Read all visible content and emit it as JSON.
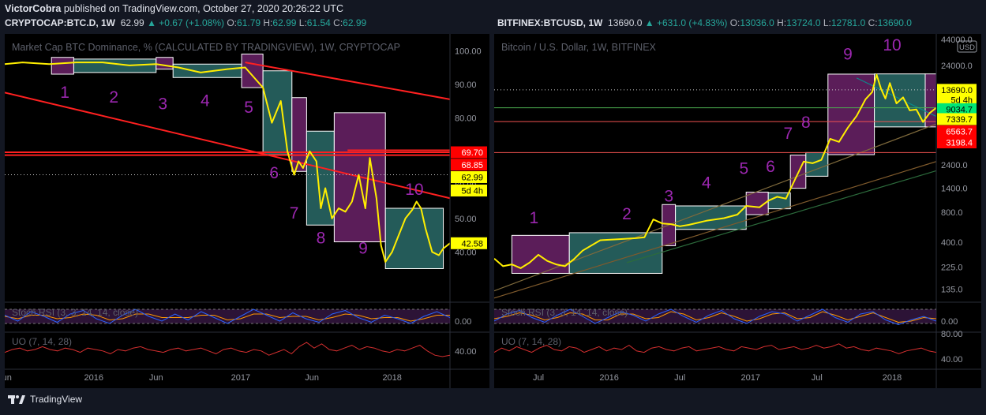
{
  "header": {
    "author": "VictorCobra",
    "published_text": "published on TradingView.com, October 27, 2020 20:26:22 UTC"
  },
  "footer": {
    "brand": "TradingView"
  },
  "colors": {
    "bull": "#26a69a",
    "bear": "#ef5350",
    "price_line": "#ffee00",
    "bg": "#131722",
    "pane": "#000000"
  },
  "chart_data": [
    {
      "type": "line",
      "symbol_header": {
        "symbol": "CRYPTOCAP:BTC.D, 1W",
        "last": "62.99",
        "change": "▲ +0.67 (+1.08%)",
        "o_label": "O:",
        "o": "61.79",
        "h_label": "H:",
        "h": "62.99",
        "l_label": "L:",
        "l": "61.54",
        "c_label": "C:",
        "c": "62.99"
      },
      "title": "Market Cap BTC Dominance, % (CALCULATED BY TRADINGVIEW), 1W, CRYPTOCAP",
      "ylim": [
        25,
        105
      ],
      "y_ticks": [
        40,
        50,
        60,
        70,
        80,
        90,
        100
      ],
      "y_tick_labels": [
        "40.00",
        "50.00",
        "60.00",
        "70.00",
        "80.00",
        "90.00",
        "100.00"
      ],
      "x_ticks": [
        {
          "t": 0.0,
          "label": "Jun"
        },
        {
          "t": 0.2,
          "label": "2016"
        },
        {
          "t": 0.34,
          "label": "Jun"
        },
        {
          "t": 0.53,
          "label": "2017"
        },
        {
          "t": 0.69,
          "label": "Jun"
        },
        {
          "t": 0.87,
          "label": "2018"
        }
      ],
      "series": [
        {
          "t": [
            0.0,
            0.04,
            0.1,
            0.16,
            0.22,
            0.28,
            0.34,
            0.39,
            0.44,
            0.5,
            0.54,
            0.58,
            0.6,
            0.62,
            0.635,
            0.65,
            0.66,
            0.67,
            0.685,
            0.7,
            0.71,
            0.72,
            0.735,
            0.75,
            0.765,
            0.78,
            0.795,
            0.81,
            0.82,
            0.835,
            0.845,
            0.855,
            0.87,
            0.885,
            0.9,
            0.915,
            0.925,
            0.935,
            0.945,
            0.96,
            0.975,
            0.985,
            1.0
          ],
          "values": [
            96.0,
            96.5,
            96.0,
            96.5,
            96.5,
            95.6,
            96.0,
            95.0,
            93.5,
            94.5,
            95.0,
            89.0,
            78.5,
            85.0,
            70.0,
            63.0,
            67.0,
            65.0,
            70.0,
            67.0,
            53.0,
            59.0,
            50.0,
            53.0,
            52.0,
            55.0,
            63.0,
            53.0,
            68.0,
            56.0,
            42.0,
            37.0,
            40.0,
            45.0,
            50.0,
            52.5,
            55.0,
            53.0,
            47.0,
            40.0,
            39.0,
            41.0,
            42.58
          ]
        }
      ],
      "boxes": [
        {
          "t0": 0.105,
          "t1": 0.155,
          "hi": 98.0,
          "lo": 93.0,
          "color": "#6b2268"
        },
        {
          "t0": 0.155,
          "t1": 0.34,
          "hi": 97.5,
          "lo": 93.5,
          "color": "#2a6b68"
        },
        {
          "t0": 0.34,
          "t1": 0.378,
          "hi": 98.0,
          "lo": 94.5,
          "color": "#6b2268"
        },
        {
          "t0": 0.378,
          "t1": 0.532,
          "hi": 96.0,
          "lo": 92.0,
          "color": "#2a6b68"
        },
        {
          "t0": 0.532,
          "t1": 0.58,
          "hi": 99.0,
          "lo": 89.0,
          "color": "#6b2268"
        },
        {
          "t0": 0.58,
          "t1": 0.645,
          "hi": 94.0,
          "lo": 69.0,
          "color": "#2a6b68"
        },
        {
          "t0": 0.645,
          "t1": 0.678,
          "hi": 86.0,
          "lo": 64.0,
          "color": "#6b2268"
        },
        {
          "t0": 0.678,
          "t1": 0.74,
          "hi": 76.0,
          "lo": 48.0,
          "color": "#2a6b68"
        },
        {
          "t0": 0.74,
          "t1": 0.855,
          "hi": 81.5,
          "lo": 43.0,
          "color": "#6b2268"
        },
        {
          "t0": 0.855,
          "t1": 0.985,
          "hi": 53.0,
          "lo": 35.0,
          "color": "#2a6b68"
        }
      ],
      "trendlines": [
        {
          "t0": 0.0,
          "v0": 87.5,
          "t1": 1.0,
          "v1": 56.0
        },
        {
          "t0": 0.54,
          "v0": 96.5,
          "t1": 1.0,
          "v1": 85.5
        }
      ],
      "hlines": [
        {
          "t0": 0.0,
          "v": 69.7
        },
        {
          "t0": 0.0,
          "v": 68.85
        },
        {
          "t0": 0.77,
          "v": 70.3
        }
      ],
      "dotted_level": 62.99,
      "wave_labels": [
        {
          "text": "1",
          "t": 0.135,
          "v": 86.0
        },
        {
          "text": "2",
          "t": 0.245,
          "v": 84.5
        },
        {
          "text": "3",
          "t": 0.355,
          "v": 82.5
        },
        {
          "text": "4",
          "t": 0.45,
          "v": 83.5
        },
        {
          "text": "5",
          "t": 0.548,
          "v": 81.5
        },
        {
          "text": "6",
          "t": 0.605,
          "v": 62.0
        },
        {
          "text": "7",
          "t": 0.65,
          "v": 50.0
        },
        {
          "text": "8",
          "t": 0.71,
          "v": 42.5
        },
        {
          "text": "9",
          "t": 0.805,
          "v": 39.5
        },
        {
          "text": "10",
          "t": 0.92,
          "v": 57.0
        }
      ],
      "price_tags": [
        {
          "text": "69.70",
          "v": 69.7,
          "bg": "#ff0000",
          "fg": "#ffffff"
        },
        {
          "text": "68.85",
          "v": 66.0,
          "bg": "#ff0000",
          "fg": "#ffffff"
        },
        {
          "text": "62.99",
          "v": 62.3,
          "bg": "#ffff00",
          "fg": "#000000"
        },
        {
          "text": "5d 4h",
          "v": 58.3,
          "bg": "#ffff00",
          "fg": "#000000"
        },
        {
          "text": "42.58",
          "v": 42.58,
          "bg": "#ffff00",
          "fg": "#000000"
        }
      ],
      "stoch": {
        "label": "Stoch RSI (3, 3, 14, 14, close)",
        "tick": "0.00",
        "k": [
          0.55,
          0.3,
          0.7,
          0.5,
          0.25,
          0.6,
          0.75,
          0.4,
          0.2,
          0.55,
          0.8,
          0.5,
          0.3,
          0.6,
          0.35,
          0.7,
          0.45,
          0.2,
          0.5,
          0.8,
          0.55,
          0.3,
          0.65,
          0.4,
          0.25,
          0.6,
          0.75,
          0.45,
          0.25,
          0.55,
          0.4,
          0.2,
          0.5,
          0.7,
          0.45
        ],
        "d": [
          0.5,
          0.4,
          0.55,
          0.55,
          0.4,
          0.45,
          0.6,
          0.55,
          0.35,
          0.4,
          0.6,
          0.6,
          0.45,
          0.45,
          0.45,
          0.55,
          0.55,
          0.35,
          0.4,
          0.6,
          0.6,
          0.45,
          0.5,
          0.5,
          0.35,
          0.45,
          0.6,
          0.55,
          0.4,
          0.45,
          0.45,
          0.3,
          0.4,
          0.55,
          0.55
        ]
      },
      "uo": {
        "label": "UO (7, 14, 28)",
        "tick": "40.00",
        "values": [
          0.4,
          0.5,
          0.55,
          0.45,
          0.5,
          0.6,
          0.5,
          0.45,
          0.55,
          0.5,
          0.4,
          0.55,
          0.5,
          0.45,
          0.35,
          0.5,
          0.45,
          0.55,
          0.6,
          0.5,
          0.45,
          0.4,
          0.5,
          0.55,
          0.45,
          0.5,
          0.55,
          0.45,
          0.35,
          0.5,
          0.55,
          0.45,
          0.4,
          0.5,
          0.45,
          0.3,
          0.4,
          0.5,
          0.35,
          0.6,
          0.75,
          0.55,
          0.7,
          0.5,
          0.45,
          0.55,
          0.65,
          0.5,
          0.6,
          0.55,
          0.45,
          0.4,
          0.5,
          0.45,
          0.55,
          0.65,
          0.45,
          0.3,
          0.25,
          0.3
        ]
      }
    },
    {
      "type": "line",
      "symbol_header": {
        "symbol": "BITFINEX:BTCUSD, 1W",
        "last": "13690.0",
        "change": "▲ +631.0 (+4.83%)",
        "o_label": "O:",
        "o": "13036.0",
        "h_label": "H:",
        "h": "13724.0",
        "l_label": "L:",
        "l": "12781.0",
        "c_label": "C:",
        "c": "13690.0"
      },
      "title": "Bitcoin / U.S. Dollar, 1W, BITFINEX",
      "log_scale": true,
      "currency_badge": "USD",
      "ylim": [
        100,
        50000
      ],
      "y_ticks": [
        135,
        225,
        400,
        800,
        1400,
        2400,
        4000,
        24000,
        44000
      ],
      "y_tick_labels": [
        "135.0",
        "225.0",
        "400.0",
        "800.0",
        "1400.0",
        "2400.0",
        "4000.0",
        "24000.0",
        "44000.0"
      ],
      "x_ticks": [
        {
          "t": 0.1,
          "label": "Jul"
        },
        {
          "t": 0.26,
          "label": "2016"
        },
        {
          "t": 0.42,
          "label": "Jul"
        },
        {
          "t": 0.58,
          "label": "2017"
        },
        {
          "t": 0.73,
          "label": "Jul"
        },
        {
          "t": 0.9,
          "label": "2018"
        }
      ],
      "series": [
        {
          "t": [
            0.0,
            0.02,
            0.04,
            0.06,
            0.08,
            0.1,
            0.12,
            0.14,
            0.16,
            0.18,
            0.2,
            0.24,
            0.28,
            0.32,
            0.34,
            0.36,
            0.38,
            0.4,
            0.42,
            0.44,
            0.48,
            0.52,
            0.55,
            0.57,
            0.6,
            0.62,
            0.64,
            0.66,
            0.68,
            0.7,
            0.72,
            0.74,
            0.76,
            0.78,
            0.8,
            0.82,
            0.84,
            0.855,
            0.865,
            0.875,
            0.885,
            0.895,
            0.91,
            0.925,
            0.94,
            0.955,
            0.97,
            0.985,
            1.0
          ],
          "values": [
            275.0,
            230.0,
            240.0,
            220.0,
            250.0,
            300.0,
            260.0,
            240.0,
            230.0,
            270.0,
            330.0,
            420.0,
            430.0,
            440.0,
            450.0,
            680.0,
            620.0,
            610.0,
            580.0,
            600.0,
            660.0,
            700.0,
            760.0,
            930.0,
            900.0,
            1050.0,
            1150.0,
            1100.0,
            1700.0,
            2600.0,
            2500.0,
            2700.0,
            4400.0,
            4100.0,
            5700.0,
            7500.0,
            11000.0,
            13000.0,
            19500.0,
            14000.0,
            11200.0,
            16000.0,
            10000.0,
            11500.0,
            8500.0,
            8700.0,
            6500.0,
            8000.0,
            9034.7
          ]
        }
      ],
      "boxes": [
        {
          "t0": 0.04,
          "t1": 0.17,
          "hi": 470,
          "lo": 195,
          "color": "#6b2268"
        },
        {
          "t0": 0.17,
          "t1": 0.38,
          "hi": 500,
          "lo": 195,
          "color": "#2a6b68"
        },
        {
          "t0": 0.38,
          "t1": 0.41,
          "hi": 960,
          "lo": 370,
          "color": "#6b2268"
        },
        {
          "t0": 0.41,
          "t1": 0.57,
          "hi": 930,
          "lo": 540,
          "color": "#2a6b68"
        },
        {
          "t0": 0.57,
          "t1": 0.62,
          "hi": 1280,
          "lo": 760,
          "color": "#6b2268"
        },
        {
          "t0": 0.62,
          "t1": 0.67,
          "hi": 1260,
          "lo": 870,
          "color": "#2a6b68"
        },
        {
          "t0": 0.67,
          "t1": 0.705,
          "hi": 3020,
          "lo": 1400,
          "color": "#6b2268"
        },
        {
          "t0": 0.705,
          "t1": 0.755,
          "hi": 3200,
          "lo": 1850,
          "color": "#2a6b68"
        },
        {
          "t0": 0.755,
          "t1": 0.86,
          "hi": 19700,
          "lo": 3050,
          "color": "#6b2268"
        },
        {
          "t0": 0.86,
          "t1": 0.975,
          "hi": 19800,
          "lo": 5800,
          "color": "#2a6b68"
        },
        {
          "t0": 0.975,
          "t1": 1.0,
          "hi": 19800,
          "lo": 5800,
          "color": "#6b2268"
        }
      ],
      "trendlines": [
        {
          "t0": 0.0,
          "v0": 130,
          "t1": 1.0,
          "v1": 6200,
          "color": "#7f6a3c"
        },
        {
          "t0": 0.0,
          "v0": 110,
          "t1": 1.0,
          "v1": 2600,
          "color": "#7f5a2c"
        },
        {
          "t0": 0.3,
          "v0": 250,
          "t1": 1.0,
          "v1": 2100,
          "color": "#2c6b3c"
        },
        {
          "t0": 0.82,
          "v0": 18000,
          "t1": 1.0,
          "v1": 7400,
          "color": "#0a8a8a"
        }
      ],
      "hlines": [
        {
          "v": 9034.7,
          "color": "#4caf50"
        },
        {
          "v": 6563.7,
          "color": "#ef5350"
        },
        {
          "v": 3198.4,
          "color": "#ef5350"
        }
      ],
      "dotted_level": 13690.0,
      "wave_labels": [
        {
          "text": "1",
          "t": 0.09,
          "v": 620
        },
        {
          "text": "2",
          "t": 0.3,
          "v": 680
        },
        {
          "text": "3",
          "t": 0.395,
          "v": 1030
        },
        {
          "text": "4",
          "t": 0.48,
          "v": 1400
        },
        {
          "text": "5",
          "t": 0.565,
          "v": 1950
        },
        {
          "text": "6",
          "t": 0.625,
          "v": 2050
        },
        {
          "text": "7",
          "t": 0.665,
          "v": 4400
        },
        {
          "text": "8",
          "t": 0.705,
          "v": 5700
        },
        {
          "text": "9",
          "t": 0.8,
          "v": 27500
        },
        {
          "text": "10",
          "t": 0.9,
          "v": 34000
        }
      ],
      "price_tags": [
        {
          "text": "13690.0",
          "v": 13690,
          "bg": "#ffff00",
          "fg": "#000000"
        },
        {
          "text": "5d 4h",
          "v": 10900,
          "bg": "#ffff00",
          "fg": "#000000"
        },
        {
          "text": "9034.7",
          "v": 8750,
          "bg": "#00e676",
          "fg": "#000000"
        },
        {
          "text": "7339.7",
          "v": 6950,
          "bg": "#ffff00",
          "fg": "#000000"
        },
        {
          "text": "6563.7",
          "v": 5250,
          "bg": "#ff0000",
          "fg": "#ffffff"
        },
        {
          "text": "3198.4",
          "v": 4050,
          "bg": "#ff0000",
          "fg": "#ffffff"
        }
      ],
      "stoch": {
        "label": "Stoch RSI (3, 3, 14, 14, close)",
        "tick": "0.00",
        "k": [
          0.3,
          0.6,
          0.75,
          0.45,
          0.25,
          0.55,
          0.8,
          0.5,
          0.2,
          0.45,
          0.7,
          0.55,
          0.3,
          0.6,
          0.8,
          0.5,
          0.25,
          0.55,
          0.75,
          0.4,
          0.2,
          0.5,
          0.7,
          0.6,
          0.3,
          0.55,
          0.8,
          0.45,
          0.25,
          0.6,
          0.7,
          0.35,
          0.15,
          0.35,
          0.5,
          0.3
        ],
        "d": [
          0.4,
          0.5,
          0.65,
          0.55,
          0.35,
          0.45,
          0.65,
          0.6,
          0.35,
          0.35,
          0.6,
          0.6,
          0.4,
          0.45,
          0.7,
          0.6,
          0.35,
          0.45,
          0.65,
          0.5,
          0.3,
          0.4,
          0.6,
          0.65,
          0.4,
          0.45,
          0.7,
          0.55,
          0.35,
          0.5,
          0.65,
          0.45,
          0.25,
          0.3,
          0.45,
          0.4
        ]
      },
      "uo": {
        "label": "UO (7, 14, 28)",
        "tick": "80.00",
        "tick2": "40.00",
        "values": [
          0.4,
          0.55,
          0.45,
          0.6,
          0.5,
          0.4,
          0.55,
          0.65,
          0.5,
          0.45,
          0.6,
          0.55,
          0.4,
          0.5,
          0.6,
          0.45,
          0.55,
          0.5,
          0.65,
          0.45,
          0.4,
          0.55,
          0.6,
          0.5,
          0.45,
          0.55,
          0.6,
          0.45,
          0.5,
          0.55,
          0.6,
          0.5,
          0.45,
          0.6,
          0.55,
          0.5,
          0.6,
          0.65,
          0.5,
          0.55,
          0.6,
          0.5,
          0.55,
          0.65,
          0.55,
          0.6,
          0.7,
          0.55,
          0.6,
          0.5,
          0.45,
          0.55,
          0.5,
          0.45,
          0.35,
          0.45,
          0.5,
          0.55,
          0.45,
          0.4
        ]
      }
    }
  ]
}
